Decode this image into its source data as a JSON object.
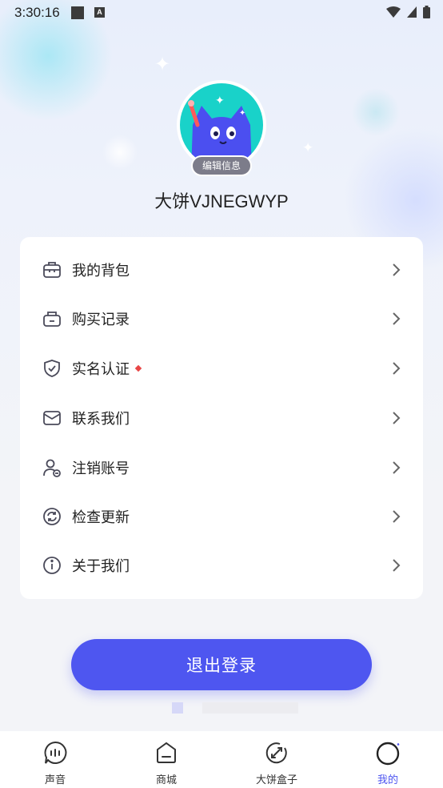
{
  "status_bar": {
    "time": "3:30:16",
    "notif_letter": "A"
  },
  "profile": {
    "edit_label": "编辑信息",
    "username": "大饼VJNEGWYP"
  },
  "menu": [
    {
      "label": "我的背包",
      "icon": "backpack-icon"
    },
    {
      "label": "购买记录",
      "icon": "shopping-bag-icon"
    },
    {
      "label": "实名认证",
      "icon": "shield-check-icon",
      "has_dot": true
    },
    {
      "label": "联系我们",
      "icon": "mail-icon"
    },
    {
      "label": "注销账号",
      "icon": "user-remove-icon"
    },
    {
      "label": "检查更新",
      "icon": "refresh-icon"
    },
    {
      "label": "关于我们",
      "icon": "info-icon"
    }
  ],
  "logout_label": "退出登录",
  "nav": [
    {
      "label": "声音",
      "icon": "chat-bubble-icon"
    },
    {
      "label": "商城",
      "icon": "shop-icon"
    },
    {
      "label": "大饼盒子",
      "icon": "link-icon"
    },
    {
      "label": "我的",
      "icon": "profile-icon",
      "active": true
    }
  ],
  "colors": {
    "accent": "#4e56f0",
    "avatar_bg": "#19d2c9",
    "cat": "#4b4ff0",
    "dot": "#e84545"
  }
}
